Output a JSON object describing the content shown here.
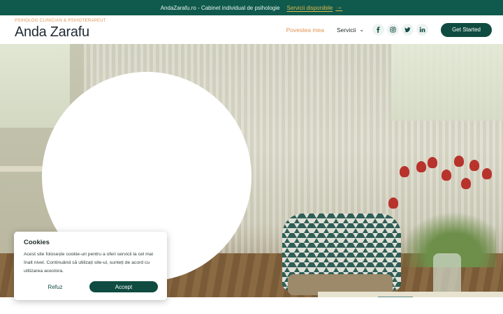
{
  "announcement": {
    "text": "AndaZarafu.ro - Cabinet individual de psihologie",
    "link_label": "Servicii disponibile",
    "arrow": "→"
  },
  "header": {
    "subtitle": "PSIHOLOG CLINICIAN & PSIHOTERAPEUT",
    "brand": "Anda Zarafu",
    "nav": {
      "story_label": "Povestea mea",
      "services_label": "Servicii",
      "chevron": "⌄"
    },
    "social": [
      "facebook-icon",
      "instagram-icon",
      "twitter-icon",
      "linkedin-icon"
    ],
    "cta_label": "Get Started"
  },
  "cookies": {
    "title": "Cookies",
    "text": "Acest site folosește cookie-uri pentru a oferi servicii la cel mai înalt nivel. Continuând să utilizați site-ul, sunteți de acord cu utilizarea acestora.",
    "refuse_label": "Refuz",
    "accept_label": "Accept"
  },
  "colors": {
    "primary": "#0f5a4c",
    "accent": "#e0934e",
    "link": "#e0b74e"
  }
}
